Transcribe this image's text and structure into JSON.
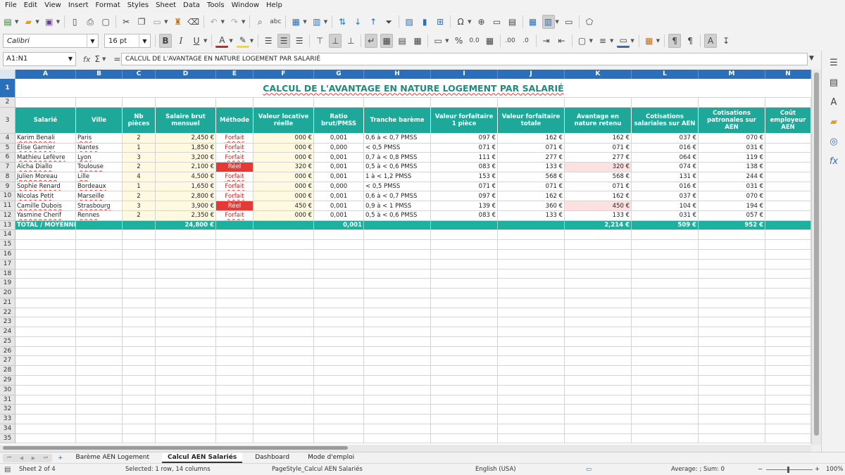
{
  "menu": [
    "File",
    "Edit",
    "View",
    "Insert",
    "Format",
    "Styles",
    "Sheet",
    "Data",
    "Tools",
    "Window",
    "Help"
  ],
  "toolbar": {
    "font_name": "Calibri",
    "font_size": "16 pt",
    "bold": "B",
    "italic": "I",
    "underline": "U",
    "font_color_glyph": "A",
    "percent": "%",
    "decimal": "0.0",
    "add_decimal": ".00",
    "remove_decimal": ".0"
  },
  "formula_bar": {
    "cell_ref": "A1:N1",
    "fx": "fx",
    "sigma": "Σ",
    "equals": "=",
    "content": "CALCUL DE L'AVANTAGE EN NATURE LOGEMENT PAR SALARIÉ"
  },
  "sheet": {
    "title": "CALCUL DE L'AVANTAGE EN NATURE LOGEMENT PAR SALARIÉ",
    "columns": [
      "A",
      "B",
      "C",
      "D",
      "E",
      "F",
      "G",
      "H",
      "I",
      "J",
      "K",
      "L",
      "M",
      "N"
    ],
    "row_numbers": [
      "1",
      "2",
      "3",
      "4",
      "5",
      "6",
      "7",
      "8",
      "9",
      "10",
      "11",
      "12",
      "13",
      "14",
      "15",
      "16",
      "17",
      "18",
      "19",
      "20",
      "21",
      "22",
      "23",
      "24",
      "25",
      "26",
      "27",
      "28",
      "29",
      "30",
      "31",
      "32",
      "33",
      "34",
      "35"
    ],
    "headers": [
      "Salarié",
      "Ville",
      "Nb pièces",
      "Salaire brut mensuel",
      "Méthode",
      "Valeur locative réelle",
      "Ratio brut/PMSS",
      "Tranche barème",
      "Valeur forfaitaire 1 pièce",
      "Valeur forfaitaire totale",
      "Avantage en nature retenu",
      "Cotisations salariales sur AEN",
      "Cotisations patronales sur AEN",
      "Coût employeur AEN"
    ],
    "rows": [
      {
        "name": "Karim Benali",
        "city": "Paris",
        "rooms": "2",
        "salary": "2,450 €",
        "method": "Forfait",
        "rental": "000 €",
        "ratio": "0,001",
        "band": "0,6 à < 0,7 PMSS",
        "v1": "097 €",
        "vtot": "162 €",
        "aen": "162 €",
        "cs": "037 €",
        "cp": "070 €",
        "cout": ""
      },
      {
        "name": "Élise Garnier",
        "city": "Nantes",
        "rooms": "1",
        "salary": "1,850 €",
        "method": "Forfait",
        "rental": "000 €",
        "ratio": "0,000",
        "band": "< 0,5 PMSS",
        "v1": "071 €",
        "vtot": "071 €",
        "aen": "071 €",
        "cs": "016 €",
        "cp": "031 €",
        "cout": ""
      },
      {
        "name": "Mathieu Lefèvre",
        "city": "Lyon",
        "rooms": "3",
        "salary": "3,200 €",
        "method": "Forfait",
        "rental": "000 €",
        "ratio": "0,001",
        "band": "0,7 à < 0,8 PMSS",
        "v1": "111 €",
        "vtot": "277 €",
        "aen": "277 €",
        "cs": "064 €",
        "cp": "119 €",
        "cout": ""
      },
      {
        "name": "Aïcha Diallo",
        "city": "Toulouse",
        "rooms": "2",
        "salary": "2,100 €",
        "method": "Réel",
        "rental": "320 €",
        "ratio": "0,001",
        "band": "0,5 à < 0,6 PMSS",
        "v1": "083 €",
        "vtot": "133 €",
        "aen": "320 €",
        "cs": "074 €",
        "cp": "138 €",
        "cout": ""
      },
      {
        "name": "Julien Moreau",
        "city": "Lille",
        "rooms": "4",
        "salary": "4,500 €",
        "method": "Forfait",
        "rental": "000 €",
        "ratio": "0,001",
        "band": "1 à < 1,2 PMSS",
        "v1": "153 €",
        "vtot": "568 €",
        "aen": "568 €",
        "cs": "131 €",
        "cp": "244 €",
        "cout": ""
      },
      {
        "name": "Sophie Renard",
        "city": "Bordeaux",
        "rooms": "1",
        "salary": "1,650 €",
        "method": "Forfait",
        "rental": "000 €",
        "ratio": "0,000",
        "band": "< 0,5 PMSS",
        "v1": "071 €",
        "vtot": "071 €",
        "aen": "071 €",
        "cs": "016 €",
        "cp": "031 €",
        "cout": ""
      },
      {
        "name": "Nicolas Petit",
        "city": "Marseille",
        "rooms": "2",
        "salary": "2,800 €",
        "method": "Forfait",
        "rental": "000 €",
        "ratio": "0,001",
        "band": "0,6 à < 0,7 PMSS",
        "v1": "097 €",
        "vtot": "162 €",
        "aen": "162 €",
        "cs": "037 €",
        "cp": "070 €",
        "cout": ""
      },
      {
        "name": "Camille Dubois",
        "city": "Strasbourg",
        "rooms": "3",
        "salary": "3,900 €",
        "method": "Réel",
        "rental": "450 €",
        "ratio": "0,001",
        "band": "0,9 à < 1 PMSS",
        "v1": "139 €",
        "vtot": "360 €",
        "aen": "450 €",
        "cs": "104 €",
        "cp": "194 €",
        "cout": ""
      },
      {
        "name": "Yasmine Cherif",
        "city": "Rennes",
        "rooms": "2",
        "salary": "2,350 €",
        "method": "Forfait",
        "rental": "000 €",
        "ratio": "0,001",
        "band": "0,5 à < 0,6 PMSS",
        "v1": "083 €",
        "vtot": "133 €",
        "aen": "133 €",
        "cs": "031 €",
        "cp": "057 €",
        "cout": ""
      }
    ],
    "total": {
      "label": "TOTAL / MOYENNE",
      "salary": "24,800 €",
      "ratio": "0,001",
      "aen": "2,214 €",
      "cs": "509 €",
      "cp": "952 €"
    }
  },
  "tabs": {
    "add": "+",
    "items": [
      "Barème AEN Logement",
      "Calcul AEN Salariés",
      "Dashboard",
      "Mode d'emploi"
    ],
    "active": "Calcul AEN Salariés"
  },
  "status": {
    "sheet": "Sheet 2 of 4",
    "selection": "Selected: 1 row, 14 columns",
    "page_style": "PageStyle_Calcul AEN Salariés",
    "language": "English (USA)",
    "sum": "Average: ; Sum: 0",
    "zoom_minus": "−",
    "zoom_plus": "+",
    "zoom": "100%"
  },
  "colors": {
    "accent": "#1ea89a",
    "title": "#1e8a80",
    "header_blue": "#2a6fbb",
    "reel_red": "#e53935"
  }
}
